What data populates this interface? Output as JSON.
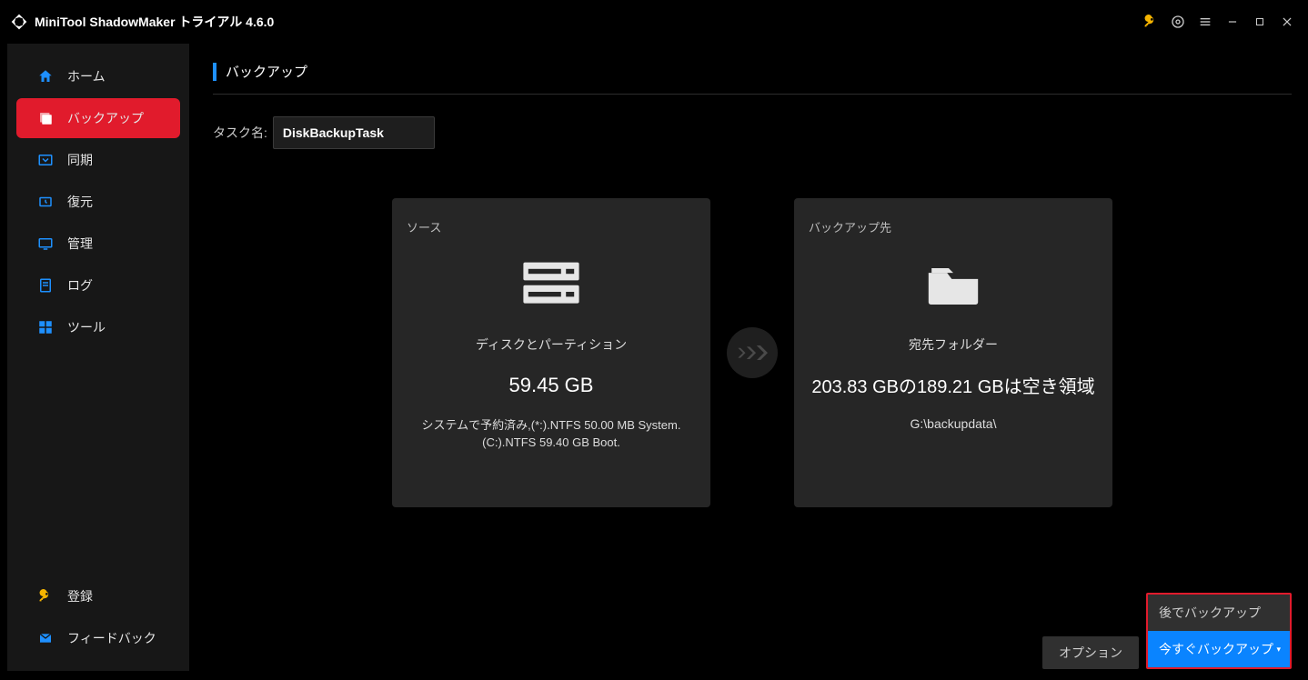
{
  "app": {
    "title": "MiniTool ShadowMaker トライアル 4.6.0"
  },
  "sidebar": {
    "items": [
      {
        "label": "ホーム"
      },
      {
        "label": "バックアップ"
      },
      {
        "label": "同期"
      },
      {
        "label": "復元"
      },
      {
        "label": "管理"
      },
      {
        "label": "ログ"
      },
      {
        "label": "ツール"
      }
    ],
    "bottom": {
      "register": "登録",
      "feedback": "フィードバック"
    }
  },
  "page": {
    "title": "バックアップ",
    "task_label": "タスク名:",
    "task_name": "DiskBackupTask"
  },
  "source_card": {
    "label": "ソース",
    "type": "ディスクとパーティション",
    "size": "59.45 GB",
    "details": "システムで予約済み,(*:).NTFS 50.00 MB System.(C:).NTFS 59.40 GB Boot."
  },
  "dest_card": {
    "label": "バックアップ先",
    "type": "宛先フォルダー",
    "size_line": "203.83 GBの189.21 GBは空き領域",
    "path": "G:\\backupdata\\"
  },
  "actions": {
    "options": "オプション",
    "later": "後でバックアップ",
    "now": "今すぐバックアップ"
  }
}
